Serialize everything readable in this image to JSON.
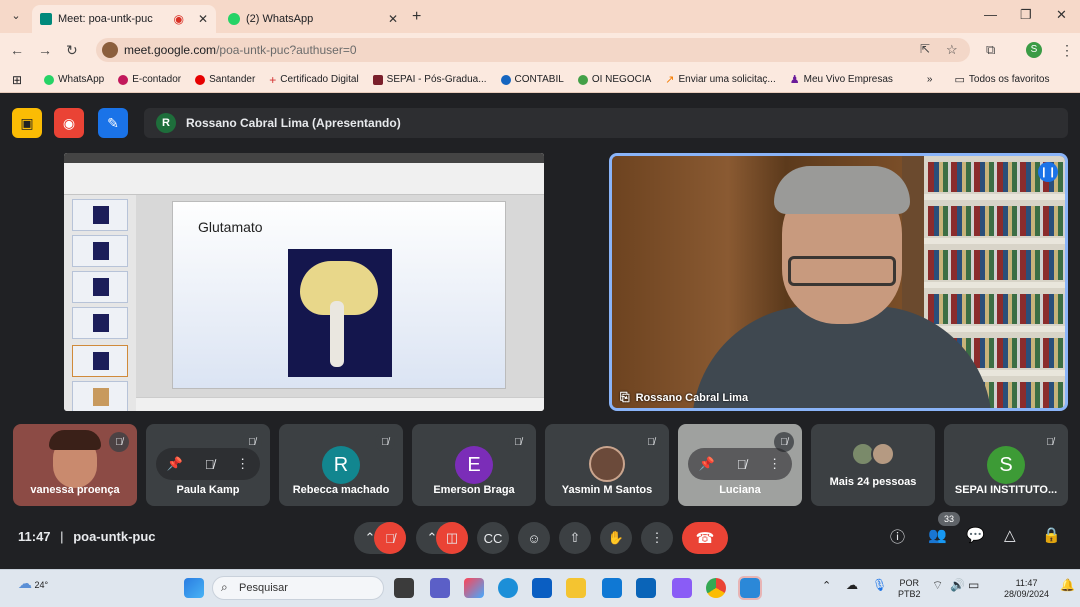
{
  "browser": {
    "tabs": [
      {
        "title": "Meet: poa-untk-puc",
        "active": true
      },
      {
        "title": "(2) WhatsApp",
        "active": false
      }
    ],
    "url_host": "meet.google.com",
    "url_path": "/poa-untk-puc?authuser=0",
    "profile_initial": "S",
    "bookmarks": [
      "WhatsApp",
      "E-contador",
      "Santander",
      "Certificado Digital",
      "SEPAI - Pós-Gradua...",
      "CONTABIL",
      "OI NEGOCIA",
      "Enviar uma solicitaç...",
      "Meu Vivo Empresas"
    ],
    "bookmarks_more": "»",
    "all_favorites": "Todos os favoritos"
  },
  "meet": {
    "presenter_initial": "R",
    "presenter_label": "Rossano Cabral Lima (Apresentando)",
    "slide_title": "Glutamato",
    "speaker_name": "Rossano Cabral Lima",
    "participants": [
      {
        "name": "vanessa proença",
        "initial": "",
        "color": ""
      },
      {
        "name": "Paula Kamp",
        "initial": "",
        "color": ""
      },
      {
        "name": "Rebecca machado",
        "initial": "R",
        "color": "#12868f"
      },
      {
        "name": "Emerson Braga",
        "initial": "E",
        "color": "#7b2db8"
      },
      {
        "name": "Yasmin M Santos",
        "initial": "",
        "color": ""
      },
      {
        "name": "Luciana",
        "initial": "",
        "color": ""
      },
      {
        "name": "Mais 24 pessoas",
        "initial": "",
        "color": ""
      },
      {
        "name": "SEPAI INSTITUTO...",
        "initial": "S",
        "color": "#3d9b36"
      }
    ],
    "time": "11:47",
    "meeting_code": "poa-untk-puc",
    "participant_count": "33"
  },
  "taskbar": {
    "temperature": "24°",
    "search_placeholder": "Pesquisar",
    "lang_top": "POR",
    "lang_bottom": "PTB2",
    "clock_time": "11:47",
    "clock_date": "28/09/2024"
  }
}
